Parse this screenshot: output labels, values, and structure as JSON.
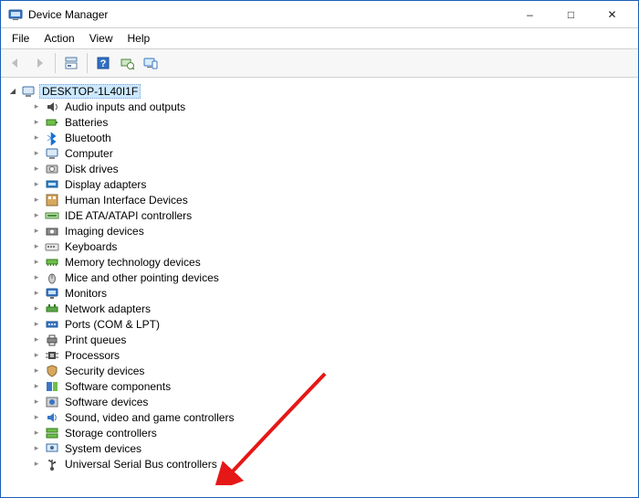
{
  "window": {
    "title": "Device Manager",
    "icon_name": "device-manager-icon"
  },
  "menubar": {
    "file": "File",
    "action": "Action",
    "view": "View",
    "help": "Help"
  },
  "toolbar": {
    "back": "back-icon",
    "forward": "forward-icon",
    "properties": "properties-icon",
    "help_btn": "help-icon",
    "scan": "scan-icon",
    "show_hidden": "show-hidden-icon"
  },
  "tree": {
    "root": {
      "label": "DESKTOP-1L40I1F",
      "icon": "computer-icon",
      "expanded": true
    },
    "children": [
      {
        "label": "Audio inputs and outputs",
        "icon": "audio-icon"
      },
      {
        "label": "Batteries",
        "icon": "battery-icon"
      },
      {
        "label": "Bluetooth",
        "icon": "bluetooth-icon"
      },
      {
        "label": "Computer",
        "icon": "computer-icon"
      },
      {
        "label": "Disk drives",
        "icon": "disk-icon"
      },
      {
        "label": "Display adapters",
        "icon": "display-adapter-icon"
      },
      {
        "label": "Human Interface Devices",
        "icon": "hid-icon"
      },
      {
        "label": "IDE ATA/ATAPI controllers",
        "icon": "ide-icon"
      },
      {
        "label": "Imaging devices",
        "icon": "imaging-icon"
      },
      {
        "label": "Keyboards",
        "icon": "keyboard-icon"
      },
      {
        "label": "Memory technology devices",
        "icon": "memory-icon"
      },
      {
        "label": "Mice and other pointing devices",
        "icon": "mouse-icon"
      },
      {
        "label": "Monitors",
        "icon": "monitor-icon"
      },
      {
        "label": "Network adapters",
        "icon": "network-icon"
      },
      {
        "label": "Ports (COM & LPT)",
        "icon": "ports-icon"
      },
      {
        "label": "Print queues",
        "icon": "printer-icon"
      },
      {
        "label": "Processors",
        "icon": "processor-icon"
      },
      {
        "label": "Security devices",
        "icon": "security-icon"
      },
      {
        "label": "Software components",
        "icon": "software-component-icon"
      },
      {
        "label": "Software devices",
        "icon": "software-device-icon"
      },
      {
        "label": "Sound, video and game controllers",
        "icon": "sound-icon"
      },
      {
        "label": "Storage controllers",
        "icon": "storage-icon"
      },
      {
        "label": "System devices",
        "icon": "system-icon"
      },
      {
        "label": "Universal Serial Bus controllers",
        "icon": "usb-icon"
      }
    ]
  },
  "annotation": {
    "type": "arrow",
    "color": "#e61717",
    "points_to": "Universal Serial Bus controllers"
  }
}
